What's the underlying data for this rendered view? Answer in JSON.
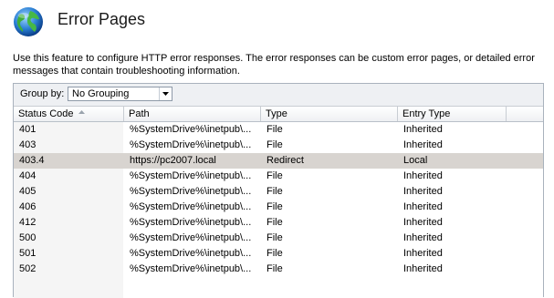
{
  "page": {
    "title": "Error Pages",
    "description": "Use this feature to configure HTTP error responses. The error responses can be custom error pages, or detailed error messages that contain troubleshooting information."
  },
  "toolbar": {
    "group_by_label": "Group by:",
    "group_by_value": "No Grouping"
  },
  "table": {
    "columns": [
      "Status Code",
      "Path",
      "Type",
      "Entry Type"
    ],
    "rows": [
      [
        "401",
        "%SystemDrive%\\inetpub\\...",
        "File",
        "Inherited"
      ],
      [
        "403",
        "%SystemDrive%\\inetpub\\...",
        "File",
        "Inherited"
      ],
      [
        "403.4",
        "https://pc2007.local",
        "Redirect",
        "Local"
      ],
      [
        "404",
        "%SystemDrive%\\inetpub\\...",
        "File",
        "Inherited"
      ],
      [
        "405",
        "%SystemDrive%\\inetpub\\...",
        "File",
        "Inherited"
      ],
      [
        "406",
        "%SystemDrive%\\inetpub\\...",
        "File",
        "Inherited"
      ],
      [
        "412",
        "%SystemDrive%\\inetpub\\...",
        "File",
        "Inherited"
      ],
      [
        "500",
        "%SystemDrive%\\inetpub\\...",
        "File",
        "Inherited"
      ],
      [
        "501",
        "%SystemDrive%\\inetpub\\...",
        "File",
        "Inherited"
      ],
      [
        "502",
        "%SystemDrive%\\inetpub\\...",
        "File",
        "Inherited"
      ]
    ],
    "selected_row": 2
  },
  "icons": {
    "header": "globe-icon",
    "sort": "sort-ascending-icon",
    "dropdown": "chevron-down-icon"
  }
}
